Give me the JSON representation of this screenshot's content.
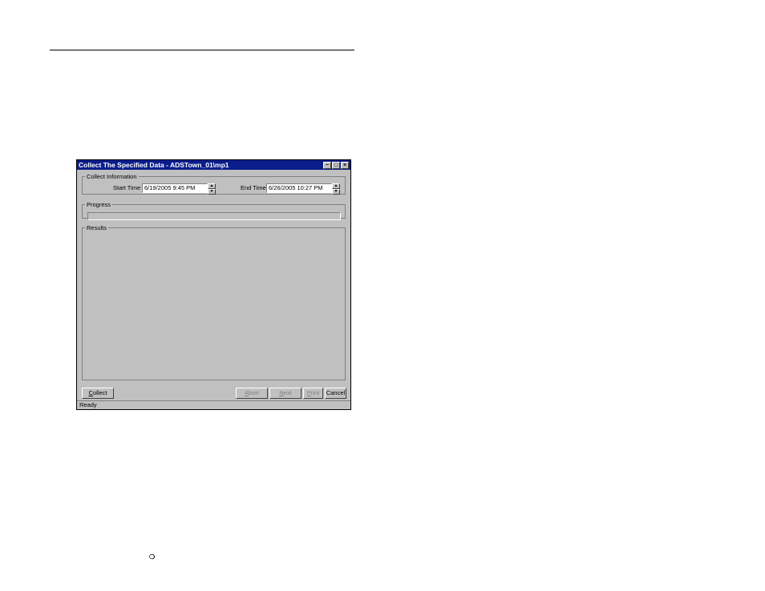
{
  "window": {
    "title": "Collect The Specified Data - ADSTown_01\\mp1",
    "min": "−",
    "max": "□",
    "close": "×"
  },
  "collectInfo": {
    "legend": "Collect Information",
    "startLabel": "Start Time",
    "startValue": "6/19/2005  9:45 PM",
    "endLabel": "End Time",
    "endValue": "6/26/2005 10:27 PM"
  },
  "progress": {
    "legend": "Progress"
  },
  "results": {
    "legend": "Results"
  },
  "buttons": {
    "collect": "Collect",
    "abort": "Abort",
    "next": "Next",
    "print": "Print",
    "cancel": "Cancel"
  },
  "status": "Ready",
  "glyphs": {
    "up": "▲",
    "down": "▼"
  },
  "bullet": "❍"
}
